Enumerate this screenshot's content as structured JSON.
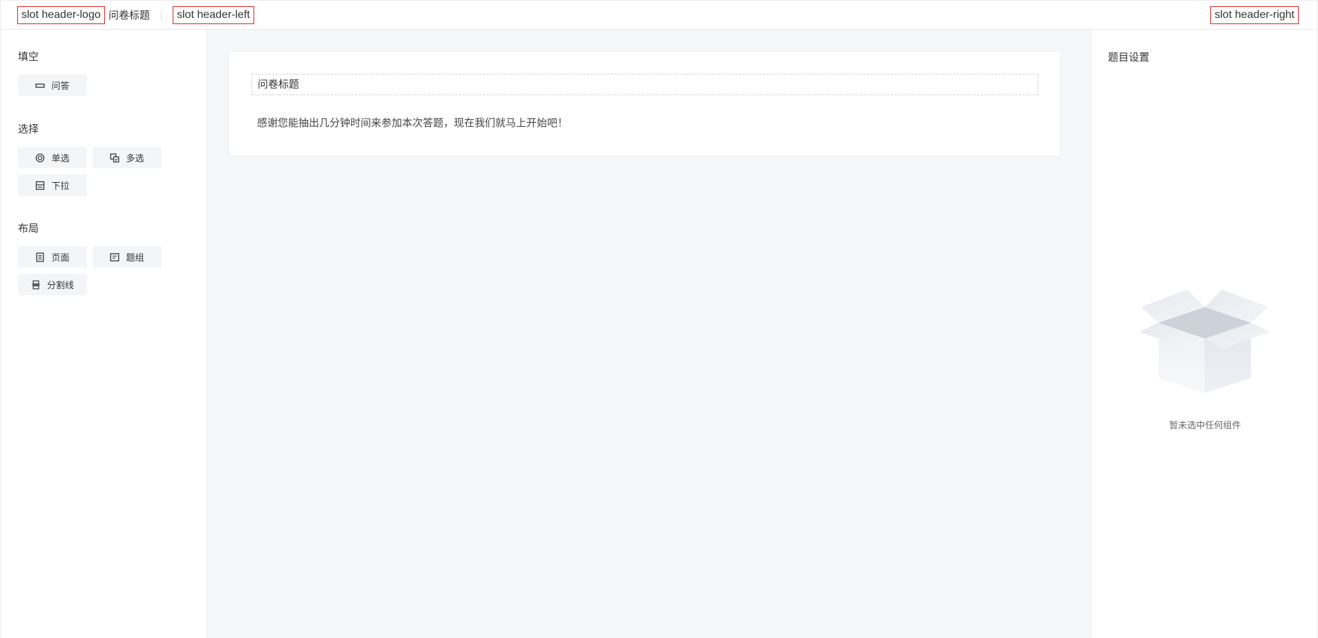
{
  "header": {
    "logo_slot": "slot header-logo",
    "title": "问卷标题",
    "left_slot": "slot header-left",
    "right_slot": "slot header-right"
  },
  "sidebar": {
    "groups": [
      {
        "title": "填空",
        "items": [
          {
            "label": "问答",
            "icon": "input-icon"
          }
        ]
      },
      {
        "title": "选择",
        "items": [
          {
            "label": "单选",
            "icon": "radio-icon"
          },
          {
            "label": "多选",
            "icon": "checkbox-icon"
          },
          {
            "label": "下拉",
            "icon": "dropdown-icon"
          }
        ]
      },
      {
        "title": "布局",
        "items": [
          {
            "label": "页面",
            "icon": "page-icon"
          },
          {
            "label": "题组",
            "icon": "group-icon"
          },
          {
            "label": "分割线",
            "icon": "divider-icon"
          }
        ]
      }
    ]
  },
  "canvas": {
    "survey_title": "问卷标题",
    "survey_description": "感谢您能抽出几分钟时间来参加本次答题，现在我们就马上开始吧！"
  },
  "settings": {
    "title": "题目设置",
    "empty_text": "暂未选中任何组件"
  },
  "colors": {
    "slot_border": "#e01e1e",
    "canvas_bg": "#f6f7f9",
    "button_bg": "#f4f5f7"
  }
}
